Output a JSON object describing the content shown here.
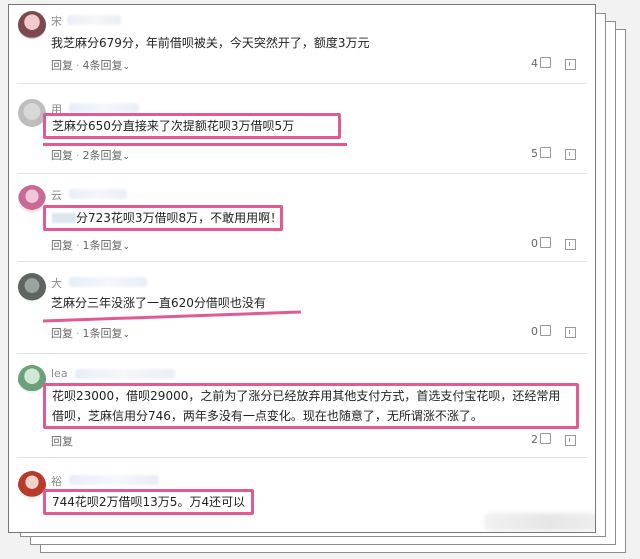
{
  "comments": [
    {
      "username": "宋",
      "text": "我芝麻分679分，年前借呗被关，今天突然开了，额度3万元",
      "reply_label": "回复",
      "replies_label": "4条回复",
      "likes": "4"
    },
    {
      "username": "用",
      "text": "芝麻分650分直接来了次提额花呗3万借呗5万",
      "reply_label": "回复",
      "replies_label": "2条回复",
      "likes": "5"
    },
    {
      "username": "云",
      "text": "分723花呗3万借呗8万，不敢用用啊！",
      "reply_label": "回复",
      "replies_label": "1条回复",
      "likes": "0"
    },
    {
      "username": "大",
      "text": "芝麻分三年没涨了一直620分借呗也没有",
      "reply_label": "回复",
      "replies_label": "1条回复",
      "likes": "0"
    },
    {
      "username": "lea",
      "text": "花呗23000，借呗29000，之前为了涨分已经放弃用其他支付方式，首选支付宝花呗，还经常用借呗，芝麻信用分746，两年多没有一点变化。现在也随意了，无所谓涨不涨了。",
      "reply_label": "回复",
      "likes": "2"
    },
    {
      "username": "裕",
      "text": "744花呗2万借呗13万5。万4还可以"
    }
  ],
  "colors": {
    "highlight": "#e15a93"
  }
}
